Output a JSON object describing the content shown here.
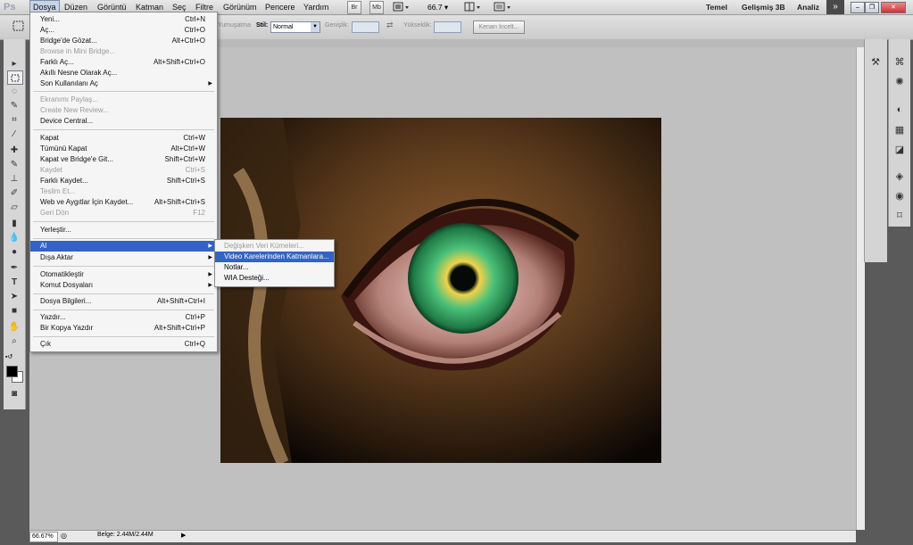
{
  "app": {
    "logo": "Ps"
  },
  "menus": [
    "Dosya",
    "Düzen",
    "Görüntü",
    "Katman",
    "Seç",
    "Filtre",
    "Görünüm",
    "Pencere",
    "Yardım"
  ],
  "toolbar": {
    "br": "Br",
    "mb": "Mb",
    "zoom": "66.7"
  },
  "workspaces": [
    "Temel",
    "Gelişmiş 3B",
    "Analiz"
  ],
  "options": {
    "feather_label": "Yumuşatma",
    "style_label": "Stil:",
    "style_value": "Normal",
    "width_label": "Genişlik:",
    "height_label": "Yükseklik:",
    "refine_edge": "Kenarı İncelt..."
  },
  "file_menu": [
    {
      "label": "Yeni...",
      "shortcut": "Ctrl+N",
      "enabled": true
    },
    {
      "label": "Aç...",
      "shortcut": "Ctrl+O",
      "enabled": true
    },
    {
      "label": "Bridge'de Gözat...",
      "shortcut": "Alt+Ctrl+O",
      "enabled": true
    },
    {
      "label": "Browse in Mini Bridge...",
      "shortcut": "",
      "enabled": false
    },
    {
      "label": "Farklı Aç...",
      "shortcut": "Alt+Shift+Ctrl+O",
      "enabled": true
    },
    {
      "label": "Akıllı Nesne Olarak Aç...",
      "shortcut": "",
      "enabled": true
    },
    {
      "label": "Son Kullanılanı Aç",
      "shortcut": "",
      "enabled": true,
      "submenu": true
    },
    {
      "label": "Ekranımı Paylaş...",
      "shortcut": "",
      "enabled": false
    },
    {
      "label": "Create New Review...",
      "shortcut": "",
      "enabled": false
    },
    {
      "label": "Device Central...",
      "shortcut": "",
      "enabled": true
    },
    {
      "label": "Kapat",
      "shortcut": "Ctrl+W",
      "enabled": true
    },
    {
      "label": "Tümünü Kapat",
      "shortcut": "Alt+Ctrl+W",
      "enabled": true
    },
    {
      "label": "Kapat ve Bridge'e Git...",
      "shortcut": "Shift+Ctrl+W",
      "enabled": true
    },
    {
      "label": "Kaydet",
      "shortcut": "Ctrl+S",
      "enabled": false
    },
    {
      "label": "Farklı Kaydet...",
      "shortcut": "Shift+Ctrl+S",
      "enabled": true
    },
    {
      "label": "Teslim Et...",
      "shortcut": "",
      "enabled": false
    },
    {
      "label": "Web ve Aygıtlar İçin Kaydet...",
      "shortcut": "Alt+Shift+Ctrl+S",
      "enabled": true
    },
    {
      "label": "Geri Dön",
      "shortcut": "F12",
      "enabled": false
    },
    {
      "label": "Yerleştir...",
      "shortcut": "",
      "enabled": true
    },
    {
      "label": "Al",
      "shortcut": "",
      "enabled": true,
      "submenu": true,
      "highlighted": true
    },
    {
      "label": "Dışa Aktar",
      "shortcut": "",
      "enabled": true,
      "submenu": true
    },
    {
      "label": "Otomatikleştir",
      "shortcut": "",
      "enabled": true,
      "submenu": true
    },
    {
      "label": "Komut Dosyaları",
      "shortcut": "",
      "enabled": true,
      "submenu": true
    },
    {
      "label": "Dosya Bilgileri...",
      "shortcut": "Alt+Shift+Ctrl+I",
      "enabled": true
    },
    {
      "label": "Yazdır...",
      "shortcut": "Ctrl+P",
      "enabled": true
    },
    {
      "label": "Bir Kopya Yazdır",
      "shortcut": "Alt+Shift+Ctrl+P",
      "enabled": true
    },
    {
      "label": "Çık",
      "shortcut": "Ctrl+Q",
      "enabled": true
    }
  ],
  "import_submenu": [
    {
      "label": "Değişken Veri Kümeleri...",
      "enabled": false
    },
    {
      "label": "Video Karelerinden Katmanlara...",
      "enabled": true,
      "highlighted": true
    },
    {
      "label": "Notlar...",
      "enabled": true
    },
    {
      "label": "WIA Desteği...",
      "enabled": true
    }
  ],
  "status": {
    "zoom": "66.67%",
    "doc": "Belge: 2.44M/2.44M"
  },
  "colors": {
    "highlight": "#3363c5",
    "canvas": "#c0c0c0",
    "iris": "#3fa86a"
  }
}
